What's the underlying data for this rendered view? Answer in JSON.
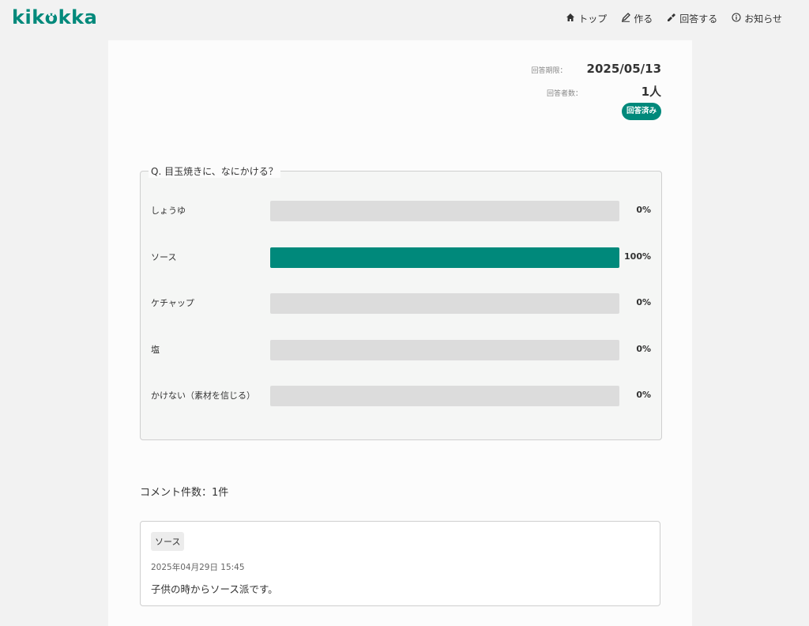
{
  "brand": {
    "name": "kikokka",
    "color": "#00897b"
  },
  "nav": [
    {
      "label": "トップ",
      "icon": "home-icon"
    },
    {
      "label": "作る",
      "icon": "pen-icon"
    },
    {
      "label": "回答する",
      "icon": "pencil-check-icon"
    },
    {
      "label": "お知らせ",
      "icon": "info-icon"
    }
  ],
  "meta": {
    "deadline_label": "回答期限：",
    "deadline_value": "2025/05/13",
    "respondents_label": "回答者数：",
    "respondents_value": "1人",
    "status_badge": "回答済み"
  },
  "question": {
    "title": "Q. 目玉焼きに、なにかける？",
    "options": [
      {
        "label": "しょうゆ",
        "percent": 0,
        "percent_label": "0%"
      },
      {
        "label": "ソース",
        "percent": 100,
        "percent_label": "100%"
      },
      {
        "label": "ケチャップ",
        "percent": 0,
        "percent_label": "0%"
      },
      {
        "label": "塩",
        "percent": 0,
        "percent_label": "0%"
      },
      {
        "label": "かけない（素材を信じる）",
        "percent": 0,
        "percent_label": "0%"
      }
    ]
  },
  "comments": {
    "count_label": "コメント件数：1件",
    "items": [
      {
        "tag": "ソース",
        "date": "2025年04月29日 15:45",
        "text": "子供の時からソース派です。"
      }
    ]
  }
}
